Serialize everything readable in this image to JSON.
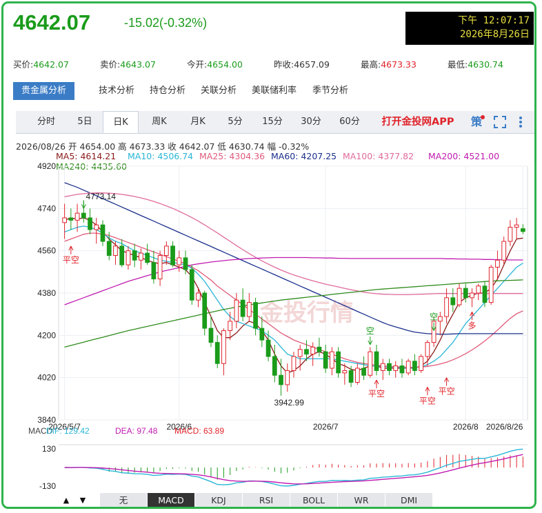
{
  "header": {
    "price": "4642.07",
    "change": "-15.02(-0.32%)",
    "clock_time": "下午 12:07:17",
    "clock_date": "2026年8月26日"
  },
  "quotes": [
    {
      "label": "买价:",
      "value": "4642.07",
      "color": "green"
    },
    {
      "label": "卖价:",
      "value": "4643.07",
      "color": "green"
    },
    {
      "label": "今开:",
      "value": "4654.00",
      "color": "green"
    },
    {
      "label": "昨收:",
      "value": "4657.09",
      "color": "plain"
    },
    {
      "label": "最高:",
      "value": "4673.33",
      "color": "red"
    },
    {
      "label": "最低:",
      "value": "4630.74",
      "color": "green"
    }
  ],
  "tabs_analysis": [
    "贵金属分析",
    "技术分析",
    "持仓分析",
    "关联分析",
    "美联储利率",
    "季节分析"
  ],
  "tabs_period": [
    "分时",
    "5日",
    "日K",
    "周K",
    "月K",
    "5分",
    "15分",
    "30分",
    "60分"
  ],
  "active_period": "日K",
  "app_link": "打开金投网APP",
  "strategy_icon": "策",
  "info_line": "2026/08/26  开 4654.00  高 4673.33  收 4642.07  低 4630.74  幅 -0.32%",
  "ma_legend": [
    {
      "label": "MA5: 4614.21",
      "color": "#8b1a1a"
    },
    {
      "label": "MA10: 4506.74",
      "color": "#29b6d6"
    },
    {
      "label": "MA25: 4304.36",
      "color": "#e05a7a"
    },
    {
      "label": "MA60: 4207.25",
      "color": "#1a2f8c"
    },
    {
      "label": "MA100: 4377.82",
      "color": "#e06a9a"
    },
    {
      "label": "MA200: 4521.00",
      "color": "#c01ab0"
    },
    {
      "label": "MA240: 4435.60",
      "color": "#2e8b1a"
    }
  ],
  "chart_data": {
    "type": "candlestick",
    "y_ticks": [
      4920,
      4740,
      4560,
      4380,
      4200,
      4020,
      3840
    ],
    "ylim": [
      3840,
      4920
    ],
    "x_ticks": [
      "2026/5/7",
      "2026/6",
      "2026/7",
      "2026/8",
      "2026/8/26"
    ],
    "annotations": {
      "high_label": "4773.14",
      "low_label": "3942.99",
      "signal_short": "平空",
      "signal_empty": "空",
      "signal_long": "多"
    },
    "candles": [
      {
        "o": 4680,
        "h": 4760,
        "l": 4610,
        "c": 4700
      },
      {
        "o": 4700,
        "h": 4740,
        "l": 4650,
        "c": 4690
      },
      {
        "o": 4690,
        "h": 4760,
        "l": 4640,
        "c": 4720
      },
      {
        "o": 4720,
        "h": 4773,
        "l": 4680,
        "c": 4700
      },
      {
        "o": 4700,
        "h": 4740,
        "l": 4630,
        "c": 4650
      },
      {
        "o": 4650,
        "h": 4700,
        "l": 4590,
        "c": 4670
      },
      {
        "o": 4670,
        "h": 4690,
        "l": 4580,
        "c": 4600
      },
      {
        "o": 4600,
        "h": 4640,
        "l": 4520,
        "c": 4540
      },
      {
        "o": 4540,
        "h": 4600,
        "l": 4500,
        "c": 4580
      },
      {
        "o": 4580,
        "h": 4610,
        "l": 4490,
        "c": 4500
      },
      {
        "o": 4500,
        "h": 4580,
        "l": 4480,
        "c": 4560
      },
      {
        "o": 4560,
        "h": 4590,
        "l": 4490,
        "c": 4520
      },
      {
        "o": 4520,
        "h": 4570,
        "l": 4480,
        "c": 4550
      },
      {
        "o": 4550,
        "h": 4590,
        "l": 4500,
        "c": 4510
      },
      {
        "o": 4510,
        "h": 4560,
        "l": 4420,
        "c": 4440
      },
      {
        "o": 4440,
        "h": 4560,
        "l": 4410,
        "c": 4540
      },
      {
        "o": 4540,
        "h": 4600,
        "l": 4500,
        "c": 4580
      },
      {
        "o": 4580,
        "h": 4600,
        "l": 4490,
        "c": 4500
      },
      {
        "o": 4500,
        "h": 4560,
        "l": 4470,
        "c": 4530
      },
      {
        "o": 4530,
        "h": 4560,
        "l": 4460,
        "c": 4480
      },
      {
        "o": 4480,
        "h": 4500,
        "l": 4330,
        "c": 4350
      },
      {
        "o": 4350,
        "h": 4400,
        "l": 4320,
        "c": 4380
      },
      {
        "o": 4380,
        "h": 4390,
        "l": 4200,
        "c": 4230
      },
      {
        "o": 4230,
        "h": 4280,
        "l": 4150,
        "c": 4170
      },
      {
        "o": 4170,
        "h": 4200,
        "l": 4060,
        "c": 4080
      },
      {
        "o": 4080,
        "h": 4230,
        "l": 4030,
        "c": 4220
      },
      {
        "o": 4220,
        "h": 4300,
        "l": 4180,
        "c": 4260
      },
      {
        "o": 4260,
        "h": 4380,
        "l": 4230,
        "c": 4350
      },
      {
        "o": 4350,
        "h": 4400,
        "l": 4260,
        "c": 4280
      },
      {
        "o": 4280,
        "h": 4380,
        "l": 4260,
        "c": 4340
      },
      {
        "o": 4340,
        "h": 4360,
        "l": 4200,
        "c": 4230
      },
      {
        "o": 4230,
        "h": 4280,
        "l": 4150,
        "c": 4180
      },
      {
        "o": 4180,
        "h": 4220,
        "l": 4090,
        "c": 4110
      },
      {
        "o": 4110,
        "h": 4160,
        "l": 4000,
        "c": 4030
      },
      {
        "o": 4030,
        "h": 4100,
        "l": 3943,
        "c": 3990
      },
      {
        "o": 3990,
        "h": 4080,
        "l": 3960,
        "c": 4050
      },
      {
        "o": 4050,
        "h": 4130,
        "l": 4020,
        "c": 4110
      },
      {
        "o": 4110,
        "h": 4160,
        "l": 4050,
        "c": 4140
      },
      {
        "o": 4140,
        "h": 4180,
        "l": 4090,
        "c": 4120
      },
      {
        "o": 4120,
        "h": 4170,
        "l": 4070,
        "c": 4150
      },
      {
        "o": 4150,
        "h": 4190,
        "l": 4110,
        "c": 4130
      },
      {
        "o": 4130,
        "h": 4160,
        "l": 4040,
        "c": 4060
      },
      {
        "o": 4060,
        "h": 4150,
        "l": 4030,
        "c": 4130
      },
      {
        "o": 4130,
        "h": 4150,
        "l": 4020,
        "c": 4040
      },
      {
        "o": 4040,
        "h": 4080,
        "l": 3990,
        "c": 4050
      },
      {
        "o": 4050,
        "h": 4070,
        "l": 3980,
        "c": 4000
      },
      {
        "o": 4000,
        "h": 4080,
        "l": 3990,
        "c": 4060
      },
      {
        "o": 4060,
        "h": 4110,
        "l": 4010,
        "c": 4030
      },
      {
        "o": 4030,
        "h": 4150,
        "l": 4020,
        "c": 4130
      },
      {
        "o": 4130,
        "h": 4160,
        "l": 4030,
        "c": 4050
      },
      {
        "o": 4050,
        "h": 4100,
        "l": 4010,
        "c": 4080
      },
      {
        "o": 4080,
        "h": 4100,
        "l": 4030,
        "c": 4050
      },
      {
        "o": 4050,
        "h": 4090,
        "l": 4020,
        "c": 4070
      },
      {
        "o": 4070,
        "h": 4100,
        "l": 4020,
        "c": 4040
      },
      {
        "o": 4040,
        "h": 4100,
        "l": 4030,
        "c": 4090
      },
      {
        "o": 4090,
        "h": 4120,
        "l": 4030,
        "c": 4050
      },
      {
        "o": 4050,
        "h": 4120,
        "l": 4040,
        "c": 4110
      },
      {
        "o": 4110,
        "h": 4180,
        "l": 4070,
        "c": 4170
      },
      {
        "o": 4170,
        "h": 4280,
        "l": 4150,
        "c": 4260
      },
      {
        "o": 4260,
        "h": 4300,
        "l": 4200,
        "c": 4280
      },
      {
        "o": 4280,
        "h": 4400,
        "l": 4250,
        "c": 4360
      },
      {
        "o": 4360,
        "h": 4400,
        "l": 4300,
        "c": 4330
      },
      {
        "o": 4330,
        "h": 4420,
        "l": 4320,
        "c": 4400
      },
      {
        "o": 4400,
        "h": 4420,
        "l": 4340,
        "c": 4360
      },
      {
        "o": 4360,
        "h": 4400,
        "l": 4320,
        "c": 4380
      },
      {
        "o": 4380,
        "h": 4420,
        "l": 4350,
        "c": 4410
      },
      {
        "o": 4410,
        "h": 4430,
        "l": 4320,
        "c": 4340
      },
      {
        "o": 4340,
        "h": 4500,
        "l": 4330,
        "c": 4490
      },
      {
        "o": 4490,
        "h": 4560,
        "l": 4440,
        "c": 4520
      },
      {
        "o": 4520,
        "h": 4620,
        "l": 4500,
        "c": 4600
      },
      {
        "o": 4600,
        "h": 4690,
        "l": 4580,
        "c": 4660
      },
      {
        "o": 4660,
        "h": 4700,
        "l": 4610,
        "c": 4670
      },
      {
        "o": 4654,
        "h": 4673,
        "l": 4631,
        "c": 4642
      }
    ],
    "ma_lines": {
      "MA5": [
        4690,
        4700,
        4695,
        4700,
        4690,
        4670,
        4640,
        4610,
        4585,
        4560,
        4550,
        4540,
        4530,
        4520,
        4510,
        4505,
        4510,
        4500,
        4490,
        4480,
        4450,
        4400,
        4340,
        4280,
        4220,
        4190,
        4190,
        4210,
        4240,
        4260,
        4250,
        4220,
        4180,
        4120,
        4070,
        4040,
        4050,
        4070,
        4100,
        4120,
        4130,
        4120,
        4100,
        4080,
        4070,
        4055,
        4050,
        4060,
        4070,
        4070,
        4060,
        4060,
        4060,
        4060,
        4060,
        4060,
        4070,
        4090,
        4130,
        4180,
        4240,
        4290,
        4340,
        4360,
        4370,
        4380,
        4380,
        4400,
        4440,
        4500,
        4560,
        4610,
        4614
      ],
      "MA10": [
        4640,
        4650,
        4660,
        4665,
        4660,
        4650,
        4635,
        4615,
        4600,
        4590,
        4575,
        4560,
        4550,
        4540,
        4530,
        4520,
        4515,
        4510,
        4505,
        4500,
        4485,
        4460,
        4430,
        4390,
        4350,
        4310,
        4280,
        4260,
        4250,
        4240,
        4230,
        4220,
        4200,
        4180,
        4150,
        4120,
        4110,
        4100,
        4100,
        4100,
        4100,
        4100,
        4100,
        4095,
        4090,
        4085,
        4080,
        4075,
        4070,
        4070,
        4068,
        4066,
        4064,
        4062,
        4060,
        4062,
        4066,
        4075,
        4090,
        4110,
        4140,
        4170,
        4210,
        4250,
        4280,
        4310,
        4340,
        4370,
        4400,
        4430,
        4460,
        4490,
        4507
      ],
      "MA25": [
        4600,
        4610,
        4620,
        4630,
        4635,
        4635,
        4630,
        4625,
        4615,
        4605,
        4595,
        4585,
        4575,
        4565,
        4555,
        4545,
        4535,
        4525,
        4515,
        4505,
        4490,
        4475,
        4455,
        4435,
        4410,
        4390,
        4370,
        4350,
        4330,
        4310,
        4290,
        4270,
        4250,
        4230,
        4210,
        4195,
        4180,
        4170,
        4160,
        4150,
        4140,
        4130,
        4120,
        4110,
        4100,
        4092,
        4085,
        4080,
        4076,
        4073,
        4070,
        4068,
        4066,
        4065,
        4064,
        4064,
        4065,
        4068,
        4072,
        4078,
        4086,
        4096,
        4108,
        4122,
        4138,
        4156,
        4176,
        4198,
        4222,
        4248,
        4272,
        4292,
        4304
      ],
      "MA60": [
        4850,
        4840,
        4830,
        4818,
        4806,
        4794,
        4782,
        4770,
        4758,
        4746,
        4734,
        4722,
        4710,
        4698,
        4686,
        4674,
        4662,
        4650,
        4638,
        4626,
        4614,
        4602,
        4590,
        4578,
        4566,
        4554,
        4542,
        4530,
        4518,
        4506,
        4494,
        4482,
        4470,
        4458,
        4446,
        4434,
        4422,
        4410,
        4398,
        4386,
        4374,
        4362,
        4350,
        4338,
        4326,
        4314,
        4302,
        4290,
        4278,
        4266,
        4254,
        4244,
        4236,
        4228,
        4220,
        4214,
        4210,
        4207,
        4206,
        4205,
        4205,
        4206,
        4207,
        4207,
        4207,
        4207,
        4207,
        4207,
        4207,
        4207,
        4207,
        4207,
        4207
      ],
      "MA100": [
        4790,
        4795,
        4800,
        4803,
        4805,
        4806,
        4806,
        4805,
        4803,
        4800,
        4796,
        4791,
        4785,
        4778,
        4770,
        4761,
        4751,
        4740,
        4728,
        4715,
        4701,
        4686,
        4670,
        4653,
        4636,
        4618,
        4600,
        4582,
        4565,
        4548,
        4532,
        4517,
        4503,
        4490,
        4478,
        4467,
        4457,
        4448,
        4440,
        4432,
        4425,
        4418,
        4412,
        4406,
        4400,
        4394,
        4389,
        4384,
        4380,
        4377,
        4375,
        4374,
        4373,
        4373,
        4373,
        4374,
        4375,
        4376,
        4377,
        4378,
        4378,
        4378,
        4378,
        4378,
        4378,
        4378,
        4378,
        4378,
        4378,
        4378,
        4378,
        4378,
        4378
      ],
      "MA200": [
        4330,
        4340,
        4350,
        4360,
        4370,
        4380,
        4390,
        4400,
        4410,
        4420,
        4430,
        4438,
        4446,
        4454,
        4462,
        4470,
        4476,
        4482,
        4488,
        4494,
        4500,
        4504,
        4508,
        4512,
        4515,
        4518,
        4521,
        4523,
        4525,
        4527,
        4528,
        4529,
        4530,
        4531,
        4531,
        4531,
        4531,
        4531,
        4531,
        4530,
        4530,
        4529,
        4529,
        4528,
        4528,
        4527,
        4527,
        4527,
        4527,
        4527,
        4527,
        4527,
        4527,
        4527,
        4527,
        4527,
        4527,
        4527,
        4527,
        4527,
        4526,
        4526,
        4525,
        4525,
        4524,
        4524,
        4523,
        4523,
        4522,
        4522,
        4521,
        4521,
        4521
      ],
      "MA240": [
        4150,
        4157,
        4164,
        4171,
        4178,
        4185,
        4192,
        4199,
        4206,
        4213,
        4220,
        4226,
        4232,
        4238,
        4244,
        4250,
        4256,
        4262,
        4268,
        4274,
        4280,
        4286,
        4292,
        4298,
        4304,
        4310,
        4315,
        4320,
        4325,
        4330,
        4334,
        4338,
        4342,
        4346,
        4350,
        4353,
        4356,
        4359,
        4362,
        4365,
        4368,
        4371,
        4374,
        4377,
        4380,
        4383,
        4386,
        4389,
        4392,
        4395,
        4397,
        4399,
        4401,
        4403,
        4405,
        4407,
        4409,
        4411,
        4413,
        4415,
        4417,
        4419,
        4421,
        4423,
        4425,
        4427,
        4429,
        4431,
        4432,
        4433,
        4434,
        4435,
        4436
      ]
    },
    "macd": {
      "label": "MACD",
      "dif_label": "DIF: 129.42",
      "dea_label": "DEA: 97.48",
      "macd_label": "MACD: 63.89",
      "dif_color": "#29b6d6",
      "dea_color": "#c01ab0",
      "macd_color": "#e0232a",
      "y_ticks": [
        130,
        -130
      ],
      "ylim": [
        -160,
        160
      ]
    }
  },
  "bottom_tabs": [
    "无",
    "MACD",
    "KDJ",
    "RSI",
    "BOLL",
    "WR",
    "DMI"
  ],
  "active_bottom_tab": "MACD",
  "arrows": {
    "up": "▲",
    "down": "▼"
  }
}
